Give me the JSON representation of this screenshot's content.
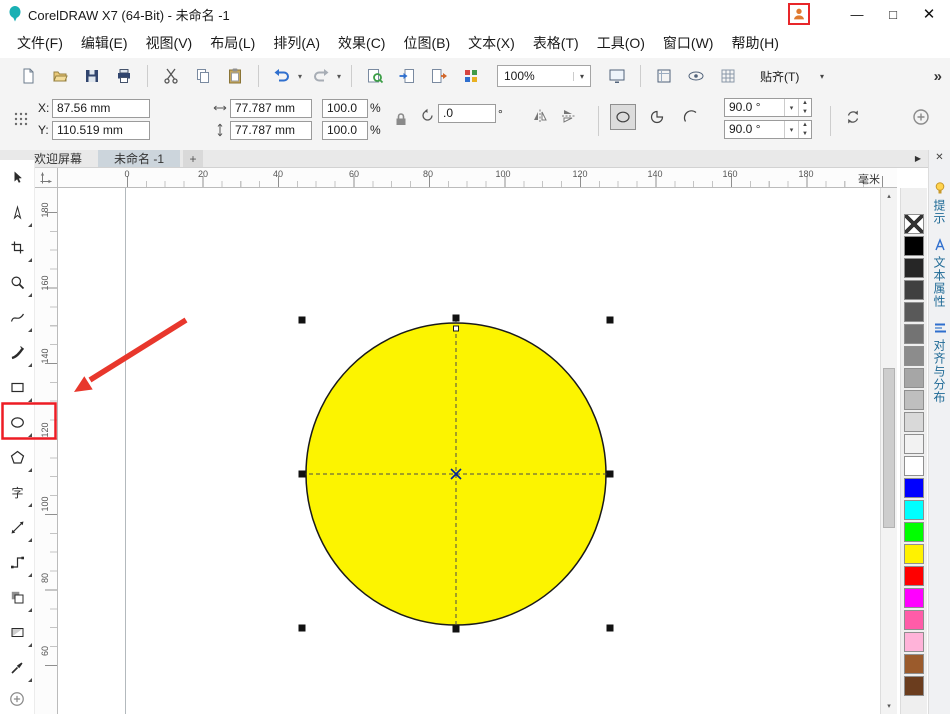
{
  "window": {
    "title": "CorelDRAW X7 (64-Bit) - 未命名 -1",
    "minimize_glyph": "—",
    "maximize_glyph": "□",
    "close_glyph": "✕"
  },
  "menu": {
    "items": [
      "文件(F)",
      "编辑(E)",
      "视图(V)",
      "布局(L)",
      "排列(A)",
      "效果(C)",
      "位图(B)",
      "文本(X)",
      "表格(T)",
      "工具(O)",
      "窗口(W)",
      "帮助(H)"
    ]
  },
  "toolbar": {
    "zoom_value": "100%",
    "snap_label": "贴齐(T)",
    "overflow_glyph": "»"
  },
  "property_bar": {
    "x_label": "X:",
    "x_value": "87.56 mm",
    "y_label": "Y:",
    "y_value": "110.519 mm",
    "width_value": "77.787 mm",
    "height_value": "77.787 mm",
    "scale_x_value": "100.0",
    "scale_y_value": "100.0",
    "percent": "%",
    "angle_value": ".0",
    "degree": "°",
    "start_angle_value": "90.0 °",
    "end_angle_value": "90.0 °"
  },
  "doc_tabs": {
    "welcome": "欢迎屏幕",
    "untitled": "未命名 -1",
    "new_tab_glyph": "+",
    "scroll_glyph": "▶"
  },
  "ruler": {
    "h_ticks": [
      "0",
      "20",
      "40",
      "60",
      "80",
      "100",
      "120",
      "140",
      "160",
      "180"
    ],
    "v_ticks": [
      "180",
      "160",
      "140",
      "120",
      "100",
      "80",
      "60"
    ],
    "unit": "毫米"
  },
  "toolbox": {
    "text_tool_glyph": "字"
  },
  "palette": {
    "colors": [
      "none",
      "#000000",
      "#262626",
      "#404040",
      "#595959",
      "#737373",
      "#8c8c8c",
      "#a6a6a6",
      "#bfbfbf",
      "#d9d9d9",
      "#f2f2f2",
      "#ffffff",
      "#0000ff",
      "#00ffff",
      "#00ff00",
      "#fff200",
      "#ff0000",
      "#ff00ff",
      "#ff5ca8",
      "#ffb3d9",
      "#9b5b2c",
      "#6b3d1e"
    ]
  },
  "dock": {
    "close_glyph": "✕",
    "tabs": [
      "提示",
      "文本属性",
      "对齐与分布"
    ]
  },
  "scrollbar": {
    "up_glyph": "▴",
    "down_glyph": "▾"
  },
  "icons": {
    "caret": "▾",
    "spin_up": "▲",
    "spin_down": "▼"
  },
  "canvas": {
    "shape_fill": "#fcf400"
  }
}
